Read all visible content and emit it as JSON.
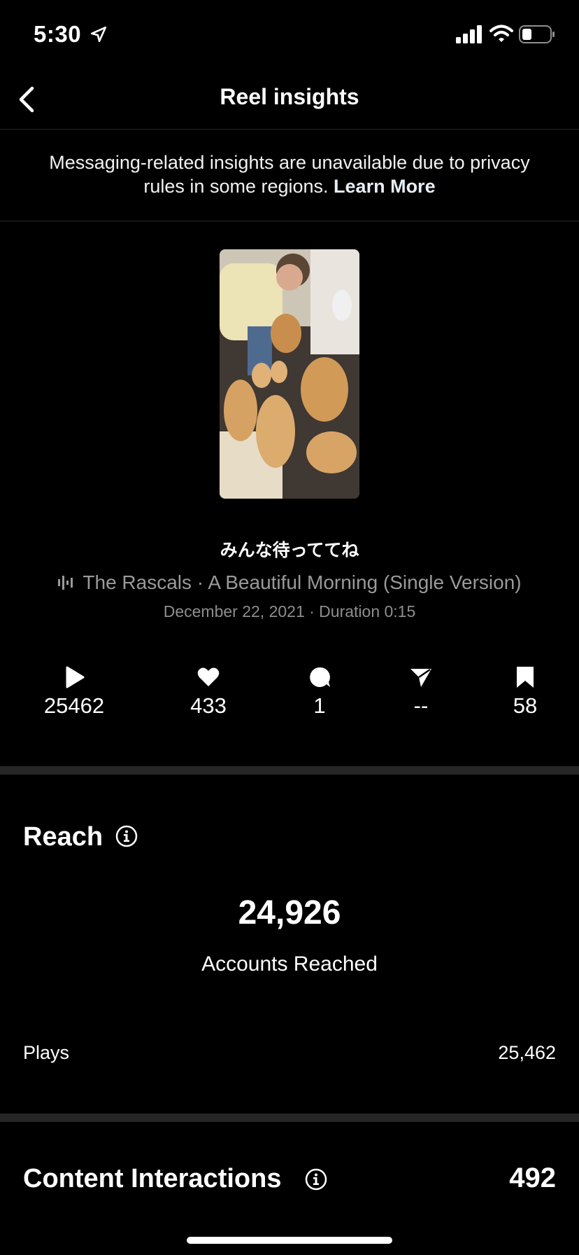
{
  "status_bar": {
    "time": "5:30"
  },
  "header": {
    "title": "Reel insights"
  },
  "notice": {
    "text": "Messaging-related insights are unavailable due to privacy rules in some regions.",
    "link": "Learn More"
  },
  "reel": {
    "caption": "みんな待っててね",
    "audio": "The Rascals · A Beautiful Morning (Single Version)",
    "meta": "December 22, 2021 · Duration 0:15"
  },
  "stats": {
    "plays": "25462",
    "likes": "433",
    "comments": "1",
    "shares": "--",
    "saves": "58"
  },
  "reach": {
    "title": "Reach",
    "accounts_reached_value": "24,926",
    "accounts_reached_label": "Accounts Reached",
    "plays_label": "Plays",
    "plays_value": "25,462"
  },
  "content_interactions": {
    "title": "Content Interactions",
    "value": "492"
  }
}
